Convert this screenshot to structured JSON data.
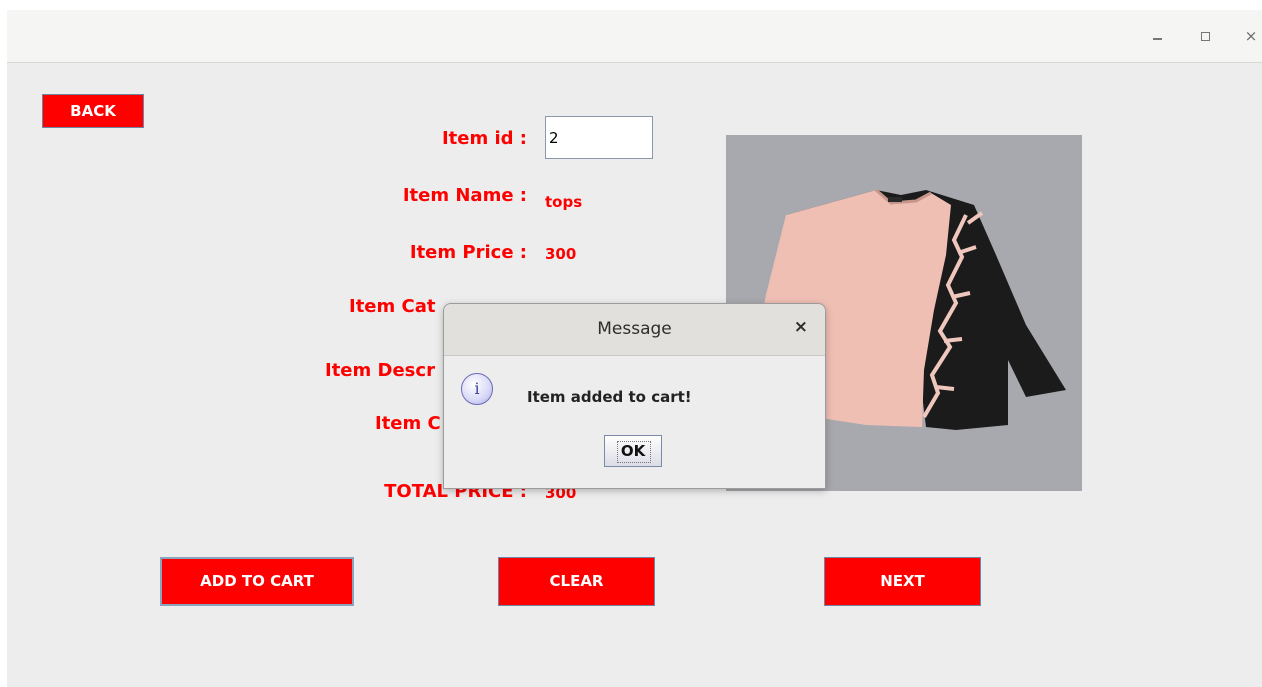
{
  "window": {
    "controls": {
      "minimize_icon": "minimize-icon",
      "maximize_icon": "maximize-icon",
      "close_glyph": "×"
    }
  },
  "buttons": {
    "back": "BACK",
    "add_to_cart": "ADD TO CART",
    "clear": "CLEAR",
    "next": "NEXT"
  },
  "form": {
    "item_id_label": "Item id :",
    "item_id_value": "2",
    "item_name_label": "Item Name :",
    "item_name_value": "tops",
    "item_price_label": "Item Price :",
    "item_price_value": "300",
    "item_category_label": "Item Cat",
    "item_category_value": "",
    "item_description_label": "Item Descr",
    "item_quantity_label": "Item C",
    "total_price_label": "TOTAL PRICE :",
    "total_price_value": "300"
  },
  "product_image": {
    "alt": "pink and black top"
  },
  "dialog": {
    "title": "Message",
    "close_glyph": "×",
    "message": "Item added to cart!",
    "ok_label": "OK",
    "icon": "info-icon"
  }
}
